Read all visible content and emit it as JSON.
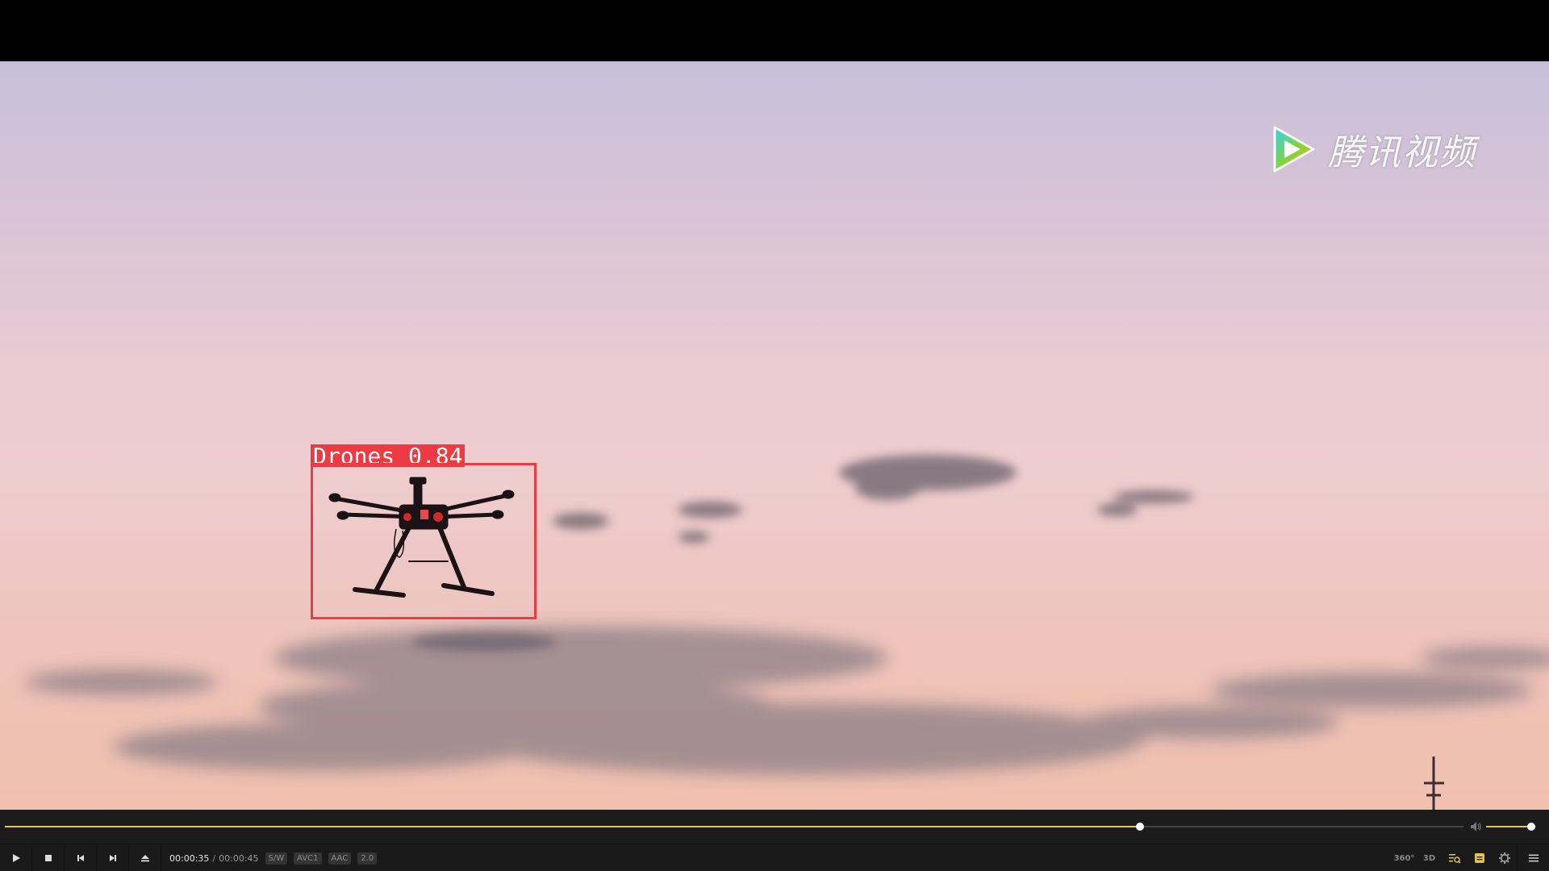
{
  "watermark": {
    "text": "腾讯视频",
    "icon": "tencent-video-play-logo"
  },
  "detection": {
    "label": "Drones 0.84",
    "color": "#ee3a43"
  },
  "playback": {
    "current_time": "00:00:35",
    "separator": "/",
    "total_time": "00:00:45",
    "progress": 0.778,
    "volume": 0.9
  },
  "tags": {
    "decoder": "S/W",
    "video_codec": "AVC1",
    "audio_codec": "AAC",
    "channels": "2.0"
  },
  "controls": {
    "play_icon": "play-icon",
    "stop_icon": "stop-icon",
    "prev_icon": "skip-previous-icon",
    "next_icon": "skip-next-icon",
    "eject_icon": "eject-icon"
  },
  "right_controls": {
    "vr": "360°",
    "three_d": "3D",
    "playlist_icon": "playlist-search-icon",
    "subtitle_icon": "subtitle-icon",
    "settings_icon": "gear-icon",
    "menu_icon": "hamburger-menu-icon"
  },
  "colors": {
    "accent": "#e8c34a",
    "bar_bg": "#1a1a1a"
  }
}
